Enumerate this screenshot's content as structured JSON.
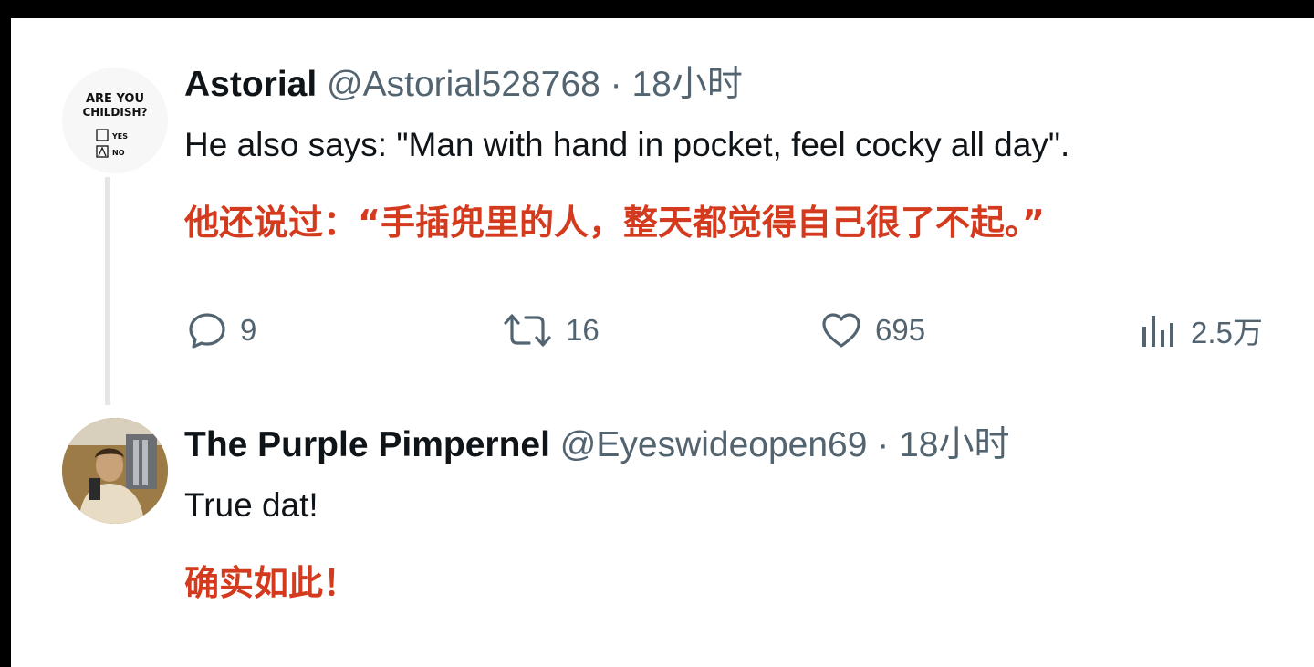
{
  "tweets": [
    {
      "name": "Astorial",
      "handle": "@Astorial528768",
      "time": "· 18小时",
      "text": "He also says: \"Man with hand in pocket, feel cocky all day\".",
      "translation": "他还说过：“手插兜里的人，整天都觉得自己很了不起。”",
      "avatar": {
        "line1": "ARE YOU",
        "line2": "CHILDISH?",
        "option_yes": "YES",
        "option_no": "NO"
      },
      "actions": {
        "reply_icon": "reply-icon",
        "reply_count": "9",
        "retweet_icon": "retweet-icon",
        "retweet_count": "16",
        "like_icon": "heart-icon",
        "like_count": "695",
        "views_icon": "views-icon",
        "views_count": "2.5万"
      }
    },
    {
      "name": "The Purple Pimpernel",
      "handle": "@Eyeswideopen69",
      "time": "· 18小时",
      "text": "True dat!",
      "translation": "确实如此！"
    }
  ],
  "colors": {
    "text": "#0f1419",
    "muted": "#536471",
    "translation": "#d33a1e",
    "thread_line": "#e6e6e6",
    "background": "#ffffff"
  }
}
